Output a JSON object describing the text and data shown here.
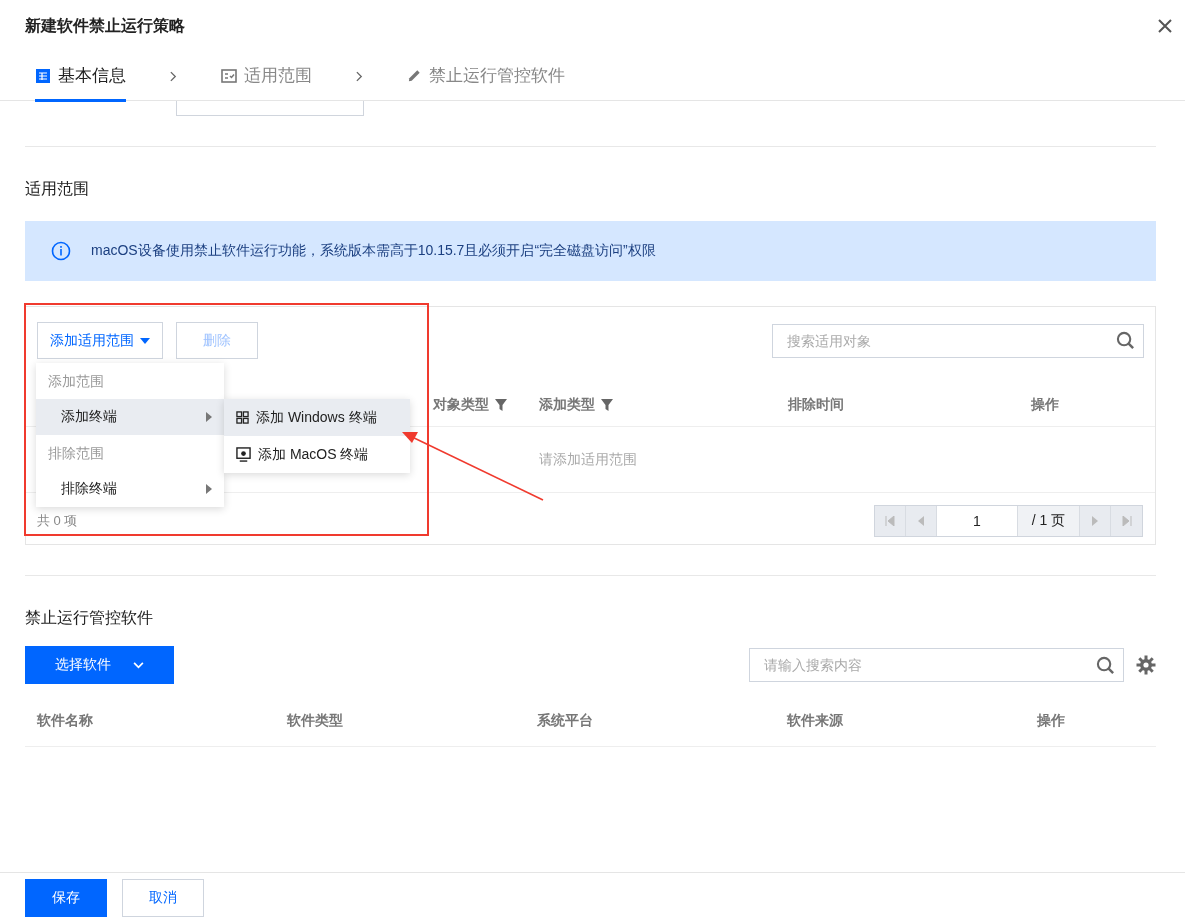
{
  "dialog": {
    "title": "新建软件禁止运行策略"
  },
  "steps": [
    {
      "label": "基本信息",
      "selected": true,
      "kind": "table"
    },
    {
      "label": "适用范围",
      "selected": false,
      "kind": "check"
    },
    {
      "label": "禁止运行管控软件",
      "selected": false,
      "kind": "pencil"
    }
  ],
  "scope_section": {
    "title": "适用范围",
    "notice": "macOS设备使用禁止软件运行功能，系统版本需高于10.15.7且必须开启“完全磁盘访问”权限",
    "add_button": "添加适用范围",
    "delete_button": {
      "label": "删除",
      "disabled": true
    },
    "search": {
      "placeholder": "搜索适用对象"
    },
    "columns": [
      {
        "label": "对象类型",
        "filter": true
      },
      {
        "label": "添加类型",
        "filter": true
      },
      {
        "label": "排除时间",
        "filter": false
      },
      {
        "label": "操作",
        "filter": false
      }
    ],
    "empty_text": "请添加适用范围",
    "total": "共 0 项",
    "pagination": {
      "page": "1",
      "pages": "/ 1 页"
    },
    "menu": [
      {
        "label": "添加范围",
        "items": [
          {
            "label": "添加终端",
            "selected": true,
            "submenu": [
              {
                "label": "添加 Windows 终端",
                "kind": "windows",
                "selected": true
              },
              {
                "label": "添加 MacOS 终端",
                "kind": "mac",
                "selected": false
              }
            ]
          }
        ]
      },
      {
        "label": "排除范围",
        "items": [
          {
            "label": "排除终端",
            "selected": false
          }
        ]
      }
    ]
  },
  "software_section": {
    "title": "禁止运行管控软件",
    "select_button": "选择软件",
    "search": {
      "placeholder": "请输入搜索内容"
    },
    "columns": [
      "软件名称",
      "软件类型",
      "系统平台",
      "软件来源",
      "操作"
    ]
  },
  "footer": {
    "buttons": [
      {
        "label": "保存",
        "kind": "primary"
      },
      {
        "label": "取消",
        "kind": "default"
      }
    ]
  }
}
